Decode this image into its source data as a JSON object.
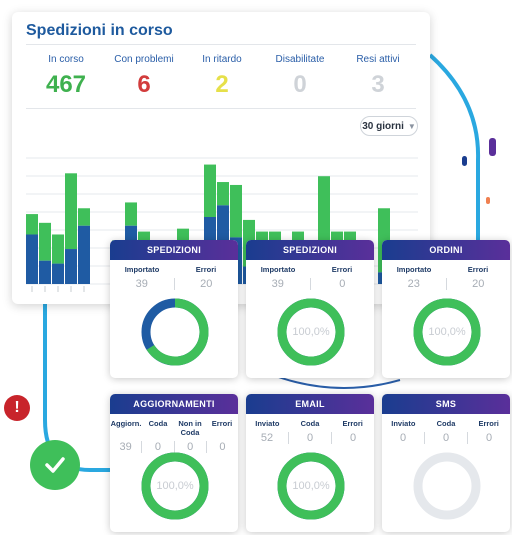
{
  "panel": {
    "title": "Spedizioni in corso",
    "period": "30 giorni",
    "stats": [
      {
        "label": "In corso",
        "value": "467",
        "color": "#3fb14f"
      },
      {
        "label": "Con problemi",
        "value": "6",
        "color": "#d23c3c"
      },
      {
        "label": "In ritardo",
        "value": "2",
        "color": "#e6e04a"
      },
      {
        "label": "Disabilitate",
        "value": "0",
        "color": "#cfd3d8"
      },
      {
        "label": "Resi attivi",
        "value": "3",
        "color": "#cfd3d8"
      }
    ]
  },
  "chart_data": {
    "type": "bar",
    "stacked": true,
    "colors": {
      "primary": "#1f5ba3",
      "secondary": "#3fbf5a"
    },
    "groups": [
      {
        "bars": [
          [
            120,
            85
          ],
          [
            105,
            40
          ],
          [
            85,
            35
          ],
          [
            190,
            60
          ],
          [
            130,
            100
          ]
        ]
      },
      {
        "bars": [
          [
            75,
            25
          ],
          [
            140,
            100
          ],
          [
            90,
            40
          ],
          [
            60,
            25
          ],
          [
            60,
            15
          ],
          [
            95,
            35
          ]
        ]
      },
      {
        "bars": [
          [
            205,
            115
          ],
          [
            175,
            135
          ],
          [
            170,
            80
          ],
          [
            110,
            30
          ],
          [
            90,
            25
          ],
          [
            90,
            20
          ]
        ]
      },
      {
        "bars": [
          [
            90,
            30
          ],
          [
            75,
            25
          ],
          [
            185,
            55
          ],
          [
            90,
            20
          ],
          [
            90,
            15
          ]
        ]
      },
      {
        "bars": [
          [
            130,
            20
          ],
          [
            50,
            30
          ],
          [
            40,
            10
          ],
          [
            30,
            10
          ]
        ]
      }
    ],
    "ylim": [
      0,
      230
    ]
  },
  "cards": [
    {
      "title": "SPEDIZIONI",
      "labels": [
        "Importato",
        "Errori"
      ],
      "values": [
        "39",
        "20"
      ],
      "pct": "",
      "fraction": 0.66,
      "color": "#3fbf5a",
      "rest": "#1f5ba3"
    },
    {
      "title": "SPEDIZIONI",
      "labels": [
        "Importato",
        "Errori"
      ],
      "values": [
        "39",
        "0"
      ],
      "pct": "100,0%",
      "fraction": 1,
      "color": "#3fbf5a",
      "rest": "#1f5ba3"
    },
    {
      "title": "ORDINI",
      "labels": [
        "Importato",
        "Errori"
      ],
      "values": [
        "23",
        "20"
      ],
      "pct": "100,0%",
      "fraction": 1,
      "color": "#3fbf5a",
      "rest": "#1f5ba3"
    },
    {
      "title": "AGGIORNAMENTI",
      "labels": [
        "Aggiorn.",
        "Coda",
        "Non in Coda",
        "Errori"
      ],
      "values": [
        "39",
        "0",
        "0",
        "0"
      ],
      "pct": "100,0%",
      "fraction": 1,
      "color": "#3fbf5a",
      "rest": "#1f5ba3"
    },
    {
      "title": "EMAIL",
      "labels": [
        "Inviato",
        "Coda",
        "Errori"
      ],
      "values": [
        "52",
        "0",
        "0"
      ],
      "pct": "100,0%",
      "fraction": 1,
      "color": "#3fbf5a",
      "rest": "#1f5ba3"
    },
    {
      "title": "SMS",
      "labels": [
        "Inviato",
        "Coda",
        "Errori"
      ],
      "values": [
        "0",
        "0",
        "0"
      ],
      "pct": "",
      "fraction": 0,
      "color": "#3fbf5a",
      "rest": "#1f5ba3"
    }
  ],
  "icons": {
    "error": "exclamation-icon",
    "success": "checkmark-icon"
  }
}
